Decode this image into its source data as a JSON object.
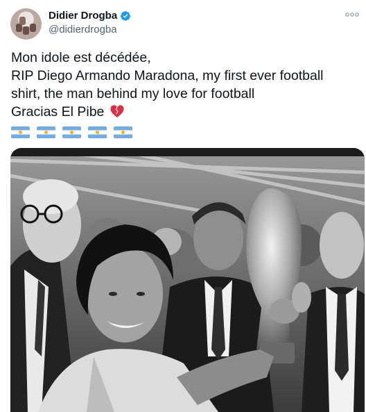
{
  "tweet": {
    "author": {
      "display_name": "Didier Drogba",
      "handle": "@didierdrogba",
      "verified": true,
      "avatar": "profile-photo"
    },
    "more_icon": "ellipsis-icon",
    "text_lines": [
      "Mon idole est décédée,",
      "RIP Diego Armando Maradona, my first ever football",
      "shirt, the man behind my love for football",
      "Gracias El Pibe"
    ],
    "emoji": {
      "broken_heart": "broken-heart-icon",
      "flags": [
        "argentina-flag-icon",
        "argentina-flag-icon",
        "argentina-flag-icon",
        "argentina-flag-icon",
        "argentina-flag-icon"
      ]
    },
    "media": {
      "type": "photo",
      "style": "black-and-white",
      "subject": "maradona-world-cup-trophy"
    }
  },
  "colors": {
    "text": "#0f1419",
    "secondary_text": "#536471",
    "verified_blue": "#1d9bf0",
    "flag_blue": "#74acdf",
    "broken_heart": "#dd2e44"
  }
}
